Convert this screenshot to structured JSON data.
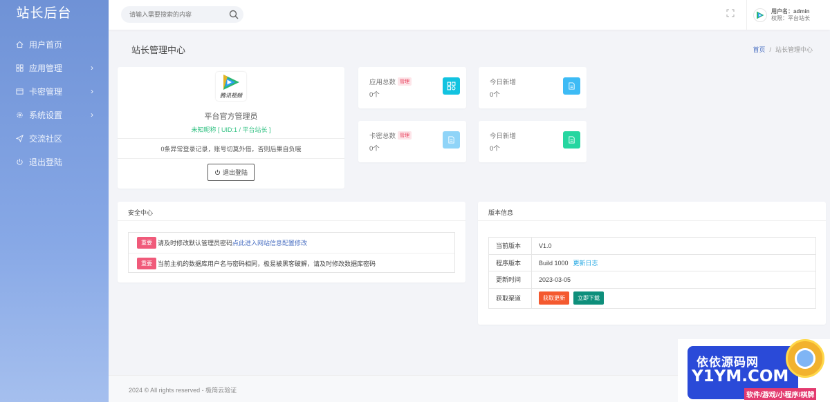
{
  "sidebar": {
    "logo": "站长后台",
    "items": [
      {
        "label": "用户首页",
        "icon": "home-icon"
      },
      {
        "label": "应用管理",
        "icon": "apps-icon",
        "has_children": true
      },
      {
        "label": "卡密管理",
        "icon": "card-icon",
        "has_children": true
      },
      {
        "label": "系统设置",
        "icon": "gear-icon",
        "has_children": true
      },
      {
        "label": "交流社区",
        "icon": "send-icon"
      },
      {
        "label": "退出登陆",
        "icon": "power-icon"
      }
    ]
  },
  "topbar": {
    "search_placeholder": "请输入需要搜索的内容",
    "user_name": "用户名：admin",
    "user_role": "权限：平台站长"
  },
  "page": {
    "title": "站长管理中心",
    "breadcrumb": {
      "home": "首页",
      "current": "站长管理中心"
    }
  },
  "profile": {
    "logo_caption": "腾讯视频",
    "role": "平台官方管理员",
    "nickname": "未知昵称 [ UID:1 / 平台站长 ]",
    "warning": "0条异常登录记录，账号切莫外借，否则后果自负哦",
    "logout_label": "退出登陆"
  },
  "stats": [
    {
      "label": "应用总数",
      "tag": "管理",
      "value": "0个",
      "icon_color": "#12c3e0"
    },
    {
      "label": "今日新增",
      "tag": "",
      "value": "0个",
      "icon_color": "#3dbbf5"
    },
    {
      "label": "卡密总数",
      "tag": "管理",
      "value": "0个",
      "icon_color": "#8fd4f8"
    },
    {
      "label": "今日新增",
      "tag": "",
      "value": "0个",
      "icon_color": "#25d6a0"
    }
  ],
  "security": {
    "title": "安全中心",
    "badge": "重要",
    "notice1_text": "请及时修改默认管理员密码 ",
    "notice1_link": "点此进入网站信息配置修改",
    "notice2_text": "当前主机的数据库用户名与密码相同，极易被黑客破解，请及时修改数据库密码"
  },
  "version": {
    "title": "版本信息",
    "rows": {
      "current": {
        "key": "当前版本",
        "value": "V1.0"
      },
      "program": {
        "key": "程序版本",
        "value": "Build 1000",
        "link": "更新日志"
      },
      "updated": {
        "key": "更新时间",
        "value": "2023-03-05"
      },
      "channel": {
        "key": "获取渠道",
        "btn1": "获取更新",
        "btn2": "立即下载"
      }
    }
  },
  "footer": {
    "text": "2024 © All rights reserved - 极简云验证"
  },
  "watermark": {
    "line1": "依依源码网",
    "line2": "Y1YM.COM",
    "line3": "软件/游戏/小程序/棋牌"
  },
  "colors": {
    "accent": "#6f92d6",
    "success": "#2fc081",
    "danger": "#f05a7a",
    "orange_btn": "#f4592f",
    "teal_btn": "#0e8f7b"
  }
}
